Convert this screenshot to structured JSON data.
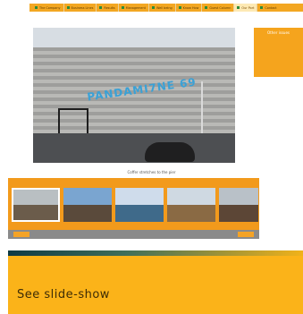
{
  "nav": {
    "items": [
      {
        "label": "The Company",
        "active": false
      },
      {
        "label": "Business Lines",
        "active": false
      },
      {
        "label": "Results",
        "active": false
      },
      {
        "label": "Management",
        "active": false
      },
      {
        "label": "Well being",
        "active": false
      },
      {
        "label": "Know How",
        "active": false
      },
      {
        "label": "Guest Column",
        "active": false
      },
      {
        "label": "Our Port",
        "active": true
      },
      {
        "label": "Contact",
        "active": false
      }
    ]
  },
  "hero": {
    "graffiti_text": "PANDAMI7NE 69"
  },
  "sidebar": {
    "title": "Other issues",
    "items": [
      "",
      "",
      "",
      "",
      "",
      ""
    ]
  },
  "gallery": {
    "caption": "Coffer stretches to the pier",
    "thumbnails": [
      {
        "name": "thumbnail-1",
        "sky": "#b9bfc2",
        "ground": "#6b5c4b"
      },
      {
        "name": "thumbnail-2",
        "sky": "#7aa5d0",
        "ground": "#5a4a3b"
      },
      {
        "name": "thumbnail-3",
        "sky": "#cfdceb",
        "ground": "#3f6a8a"
      },
      {
        "name": "thumbnail-4",
        "sky": "#cfd9e2",
        "ground": "#8a6a44"
      },
      {
        "name": "thumbnail-5",
        "sky": "#b9c1c8",
        "ground": "#5c4636"
      }
    ],
    "prev_label": "",
    "next_label": ""
  },
  "banner": {
    "link_text": "See slide-show"
  }
}
